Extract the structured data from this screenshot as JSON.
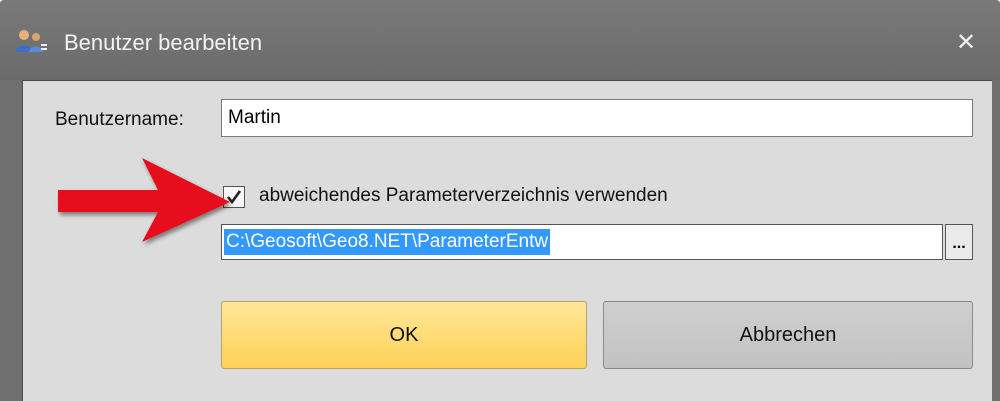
{
  "window": {
    "title": "Benutzer bearbeiten",
    "close_glyph": "✕"
  },
  "form": {
    "username_label": "Benutzername:",
    "username_value": "Martin",
    "checkbox_label": "abweichendes Parameterverzeichnis verwenden",
    "checkbox_checked": true,
    "path_value": "C:\\Geosoft\\Geo8.NET\\ParameterEntw",
    "browse_label": "..."
  },
  "buttons": {
    "ok_label": "OK",
    "cancel_label": "Abbrechen"
  },
  "annotation": {
    "arrow_icon": "red-arrow-icon",
    "arrow_color": "#e8101a"
  },
  "colors": {
    "titlebar": "#6f6f6f",
    "client_bg": "#dcdcdc",
    "ok_button": "#ffd257",
    "selection": "#3399ff"
  }
}
